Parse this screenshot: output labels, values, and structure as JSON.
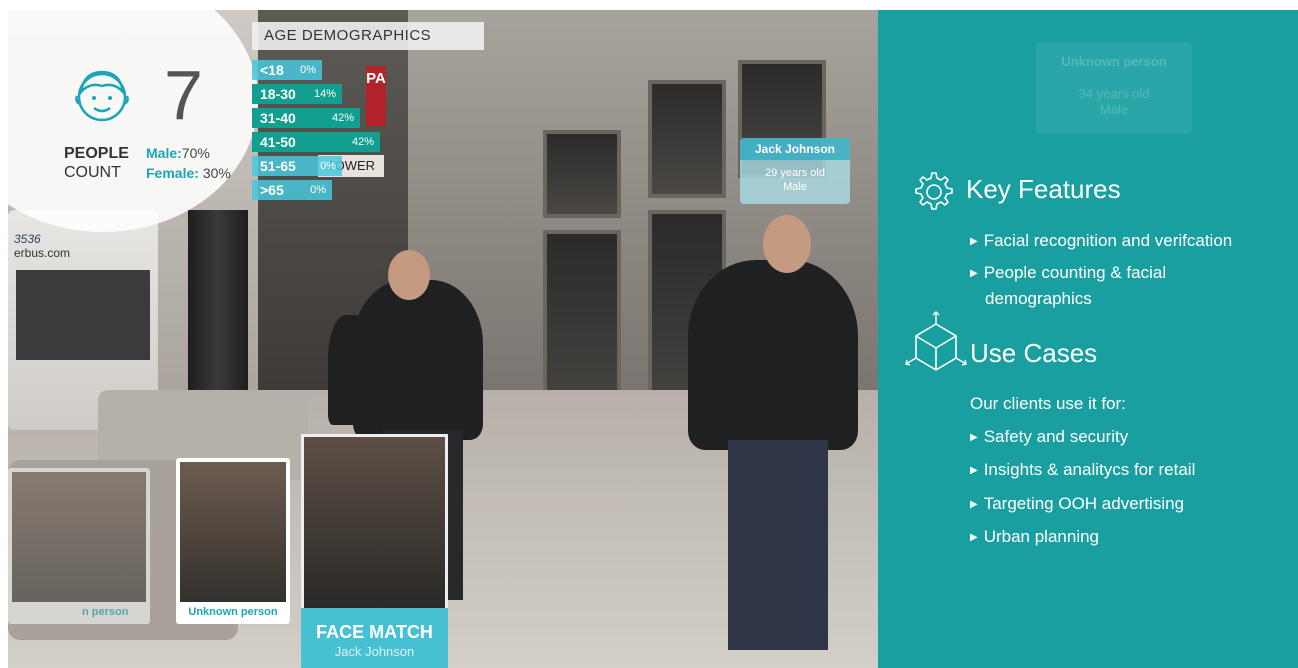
{
  "hud": {
    "people_count": "7",
    "people_label": "PEOPLE",
    "count_label": "COUNT",
    "male_label": "Male:",
    "male_value": "70%",
    "female_label": "Female:",
    "female_value": "30%"
  },
  "age_demographics": {
    "title": "AGE DEMOGRAPHICS",
    "rows": [
      {
        "label": "<18",
        "pct": "0%"
      },
      {
        "label": "18-30",
        "pct": "14%"
      },
      {
        "label": "31-40",
        "pct": "42%"
      },
      {
        "label": "41-50",
        "pct": "42%"
      },
      {
        "label": "51-65",
        "pct": "0%"
      },
      {
        "label": ">65",
        "pct": "0%"
      }
    ]
  },
  "scene_text": {
    "store_sign": "TOWER",
    "pa_sign": "PA",
    "bus_text": "3536",
    "bus_web": "erbus.com"
  },
  "name_tag": {
    "name": "Jack Johnson",
    "age": "29 years old",
    "gender": "Male"
  },
  "face_cards": [
    {
      "caption": "n person"
    },
    {
      "caption": "Unknown person"
    }
  ],
  "face_match": {
    "title": "FACE MATCH",
    "name": "Jack Johnson"
  },
  "panel": {
    "ghost_tag": {
      "name": "Unknown person",
      "age": "34 years old",
      "gender": "Male"
    },
    "key_features_title": "Key Features",
    "key_features": [
      "Facial recognition and verifcation",
      "People counting & facial",
      "demographics"
    ],
    "use_cases_title": "Use Cases",
    "use_cases_intro": "Our clients use it for:",
    "use_cases": [
      "Safety and security",
      "Insights & analitycs for retail",
      "Targeting OOH  advertising",
      "Urban planning"
    ],
    "accent_color": "#1a9fa1"
  }
}
